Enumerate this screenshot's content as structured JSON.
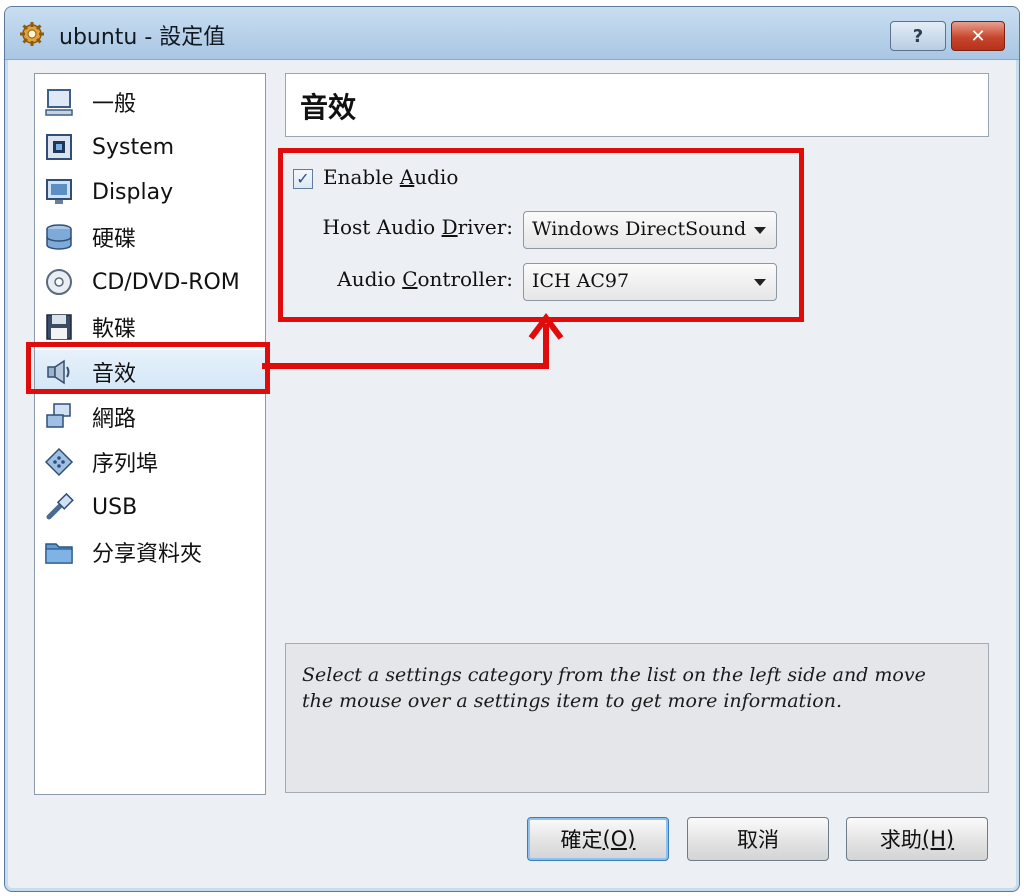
{
  "window": {
    "title": "ubuntu - 設定值"
  },
  "sidebar": {
    "items": [
      {
        "label": "一般",
        "icon": "monitor-icon"
      },
      {
        "label": "System",
        "icon": "chip-icon"
      },
      {
        "label": "Display",
        "icon": "display-icon"
      },
      {
        "label": "硬碟",
        "icon": "hard-disk-icon"
      },
      {
        "label": "CD/DVD-ROM",
        "icon": "cd-icon"
      },
      {
        "label": "軟碟",
        "icon": "floppy-icon"
      },
      {
        "label": "音效",
        "icon": "speaker-icon",
        "selected": true
      },
      {
        "label": "網路",
        "icon": "network-icon"
      },
      {
        "label": "序列埠",
        "icon": "serial-port-icon"
      },
      {
        "label": "USB",
        "icon": "usb-icon"
      },
      {
        "label": "分享資料夾",
        "icon": "folder-icon"
      }
    ]
  },
  "page": {
    "title": "音效"
  },
  "audio": {
    "enable_label_pre": "Enable ",
    "enable_label_mnemonic": "A",
    "enable_label_post": "udio",
    "enabled": true,
    "host_driver_label_pre": "Host Audio ",
    "host_driver_label_mnemonic": "D",
    "host_driver_label_post": "river:",
    "host_driver_value": "Windows DirectSound",
    "controller_label_pre": "Audio ",
    "controller_label_mnemonic": "C",
    "controller_label_post": "ontroller:",
    "controller_value": "ICH AC97"
  },
  "info": {
    "text": "Select a settings category from the list on the left side and move the mouse over a settings item to get more information."
  },
  "buttons": {
    "ok_label": "確定",
    "ok_mnemonic": "(O)",
    "cancel_label": "取消",
    "help_label": "求助",
    "help_mnemonic": "(H)"
  },
  "colors": {
    "highlight": "#e00b0b",
    "selection": "#d3e6f6"
  }
}
